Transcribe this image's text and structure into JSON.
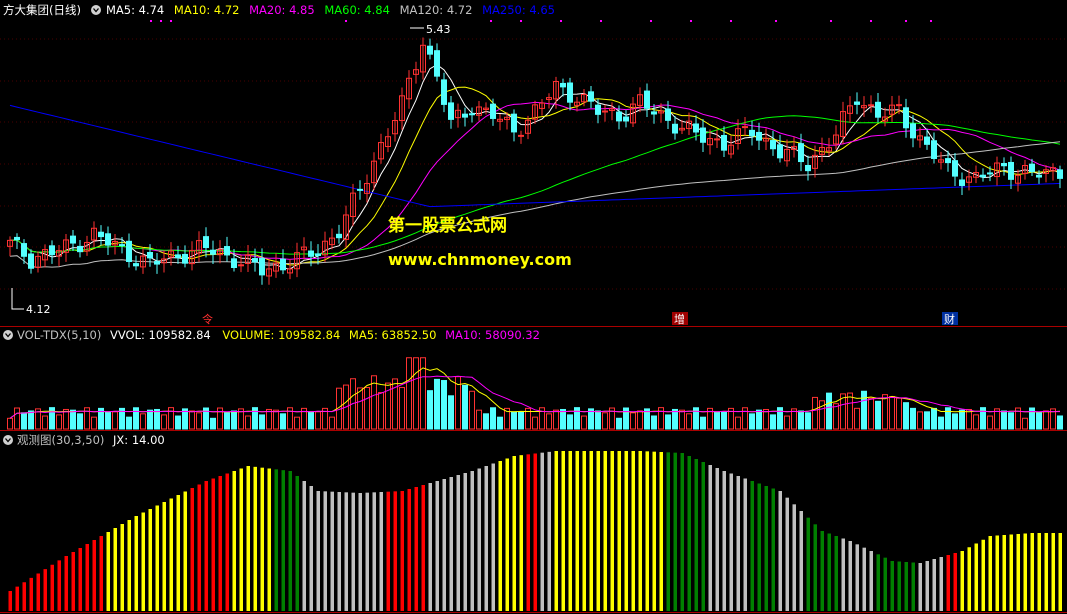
{
  "price_panel": {
    "title": "方大集团(日线)",
    "ma_labels": [
      {
        "text": "MA5: 4.74",
        "color": "#ffffff"
      },
      {
        "text": "MA10: 4.72",
        "color": "#ffff00"
      },
      {
        "text": "MA20: 4.85",
        "color": "#ff00ff"
      },
      {
        "text": "MA60: 4.84",
        "color": "#00ff00"
      },
      {
        "text": "MA120: 4.72",
        "color": "#c0c0c0"
      },
      {
        "text": "MA250: 4.65",
        "color": "#0000ff"
      }
    ],
    "high_label": "5.43",
    "low_label": "4.12",
    "watermark_cn": "第一股票公式网",
    "watermark_url": "www.chnmoney.com",
    "markers": [
      {
        "text": "令",
        "color": "#ff3030",
        "bg": ""
      },
      {
        "text": "增",
        "color": "#ffffff",
        "bg": "#a00000"
      },
      {
        "text": "财",
        "color": "#ffffff",
        "bg": "#0030a0"
      }
    ]
  },
  "volume_panel": {
    "labels": [
      {
        "text": "VOL-TDX(5,10)",
        "color": "#c0c0c0"
      },
      {
        "text": "VVOL: 109582.84",
        "color": "#ffffff"
      },
      {
        "text": "VOLUME: 109582.84",
        "color": "#ffff00"
      },
      {
        "text": "MA5: 63852.50",
        "color": "#ffff00"
      },
      {
        "text": "MA10: 58090.32",
        "color": "#ff00ff"
      }
    ]
  },
  "indicator_panel": {
    "labels": [
      {
        "text": "观测图(30,3,50)",
        "color": "#c0c0c0"
      },
      {
        "text": "JX: 14.00",
        "color": "#ffffff"
      }
    ]
  },
  "colors": {
    "up": "#ff3232",
    "down": "#54ffff",
    "panel_border": "#aa0000",
    "ma5": "#ffffff",
    "ma10": "#ffff00",
    "ma20": "#ff00ff",
    "ma60": "#00ff00",
    "ma120": "#c0c0c0",
    "ma250": "#0000ff",
    "ind_red": "#ff0000",
    "ind_yellow": "#ffff00",
    "ind_green": "#008000",
    "ind_gray": "#c0c0c0"
  }
}
